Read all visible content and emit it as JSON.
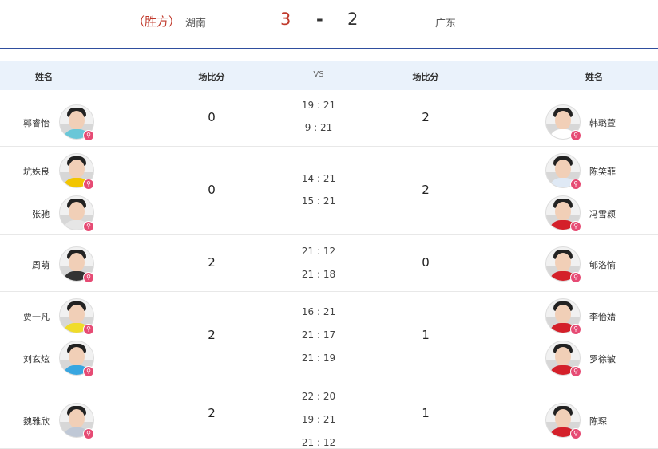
{
  "header": {
    "winner_label": "（胜方）",
    "team1": "湖南",
    "score1": "3",
    "dash": "-",
    "score2": "2",
    "team2": "广东"
  },
  "table": {
    "columns": [
      "姓名",
      "场比分",
      "VS",
      "场比分",
      "姓名"
    ]
  },
  "badge_icon": "ping-pong-paddle-icon",
  "matches": [
    {
      "left_players": [
        "郭睿怡"
      ],
      "left_score": "0",
      "games": [
        "19 : 21",
        "9 : 21"
      ],
      "right_score": "2",
      "right_players": [
        "韩璐萱"
      ]
    },
    {
      "left_players": [
        "坑姝良",
        "张驰"
      ],
      "left_score": "0",
      "games": [
        "14 : 21",
        "15 : 21"
      ],
      "right_score": "2",
      "right_players": [
        "陈笑菲",
        "冯雪颖"
      ]
    },
    {
      "left_players": [
        "周萌"
      ],
      "left_score": "2",
      "games": [
        "21 : 12",
        "21 : 18"
      ],
      "right_score": "0",
      "right_players": [
        "郇洛愉"
      ]
    },
    {
      "left_players": [
        "贾一凡",
        "刘玄炫"
      ],
      "left_score": "2",
      "games": [
        "16 : 21",
        "21 : 17",
        "21 : 19"
      ],
      "right_score": "1",
      "right_players": [
        "李怡婧",
        "罗徐敏"
      ]
    },
    {
      "left_players": [
        "魏雅欣"
      ],
      "left_score": "2",
      "games": [
        "22 : 20",
        "19 : 21",
        "21 : 12"
      ],
      "right_score": "1",
      "right_players": [
        "陈琛"
      ]
    }
  ]
}
